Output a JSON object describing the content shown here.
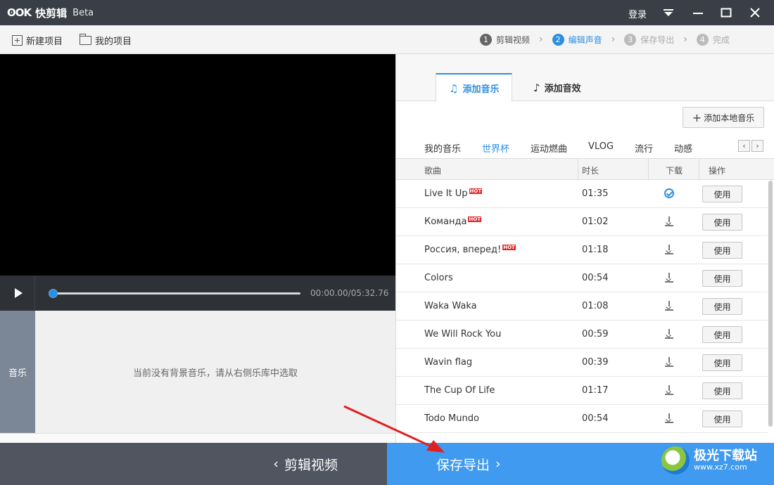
{
  "app": {
    "logo_mark": "ʘOK",
    "name": "快剪辑",
    "badge": "Beta",
    "login": "登录"
  },
  "toolbar": {
    "new_project": "新建项目",
    "my_projects": "我的项目"
  },
  "steps": [
    {
      "num": "1",
      "label": "剪辑视频",
      "state": "done"
    },
    {
      "num": "2",
      "label": "编辑声音",
      "state": "active"
    },
    {
      "num": "3",
      "label": "保存导出",
      "state": "inactive"
    },
    {
      "num": "4",
      "label": "完成",
      "state": "inactive"
    }
  ],
  "player": {
    "time": "00:00.00/05:32.76",
    "progress_fraction": 0.0
  },
  "track": {
    "label": "音乐",
    "empty_message": "当前没有背景音乐，请从右侧乐库中选取"
  },
  "panel": {
    "tab_music": "添加音乐",
    "tab_effects": "添加音效",
    "add_local": "添加本地音乐",
    "categories": [
      "我的音乐",
      "世界杯",
      "运动燃曲",
      "VLOG",
      "流行",
      "动感"
    ],
    "active_category": "世界杯",
    "columns": {
      "song": "歌曲",
      "duration": "时长",
      "download": "下载",
      "action": "操作"
    },
    "use_label": "使用",
    "hot_label": "HOT",
    "songs": [
      {
        "title": "Live It Up",
        "duration": "01:35",
        "hot": true,
        "downloaded": true
      },
      {
        "title": "Команда",
        "duration": "01:02",
        "hot": true,
        "downloaded": false
      },
      {
        "title": "Россия, вперед!",
        "duration": "01:18",
        "hot": true,
        "downloaded": false
      },
      {
        "title": "Colors",
        "duration": "00:54",
        "hot": false,
        "downloaded": false
      },
      {
        "title": "Waka Waka",
        "duration": "01:08",
        "hot": false,
        "downloaded": false
      },
      {
        "title": "We Will Rock You",
        "duration": "00:59",
        "hot": false,
        "downloaded": false
      },
      {
        "title": "Wavin flag",
        "duration": "00:39",
        "hot": false,
        "downloaded": false
      },
      {
        "title": "The Cup Of Life",
        "duration": "01:17",
        "hot": false,
        "downloaded": false
      },
      {
        "title": "Todo Mundo",
        "duration": "00:54",
        "hot": false,
        "downloaded": false
      }
    ]
  },
  "bottom": {
    "back": "剪辑视频",
    "next": "保存导出"
  },
  "watermark": {
    "name": "极光下载站",
    "url": "www.xz7.com"
  },
  "colors": {
    "accent": "#2d8fe3",
    "next_button": "#3f9af0",
    "annotation_arrow": "#e02020"
  }
}
